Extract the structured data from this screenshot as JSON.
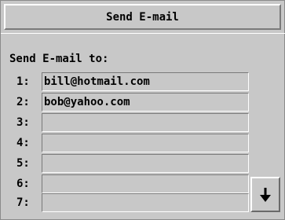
{
  "dialog": {
    "title": "Send E-mail",
    "heading": "Send E-mail to:"
  },
  "recipients": [
    {
      "number": "1:",
      "value": "bill@hotmail.com"
    },
    {
      "number": "2:",
      "value": "bob@yahoo.com"
    },
    {
      "number": "3:",
      "value": ""
    },
    {
      "number": "4:",
      "value": ""
    },
    {
      "number": "5:",
      "value": ""
    },
    {
      "number": "6:",
      "value": ""
    },
    {
      "number": "7:",
      "value": ""
    }
  ],
  "scroll": {
    "icon": "arrow-down-icon"
  }
}
